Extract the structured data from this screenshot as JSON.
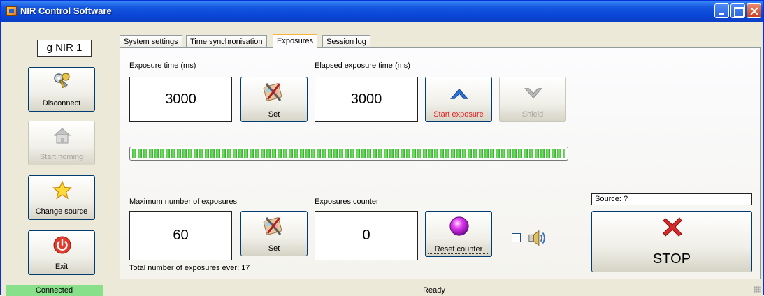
{
  "window": {
    "title": "NIR Control Software"
  },
  "sidebar": {
    "device_name": "g NIR 1",
    "buttons": [
      {
        "label": "Disconnect",
        "icon": "keys-icon",
        "enabled": true
      },
      {
        "label": "Start homing",
        "icon": "home-icon",
        "enabled": false
      },
      {
        "label": "Change source",
        "icon": "star-icon",
        "enabled": true
      },
      {
        "label": "Exit",
        "icon": "power-icon",
        "enabled": true
      }
    ]
  },
  "tabs": [
    {
      "label": "System settings",
      "active": false
    },
    {
      "label": "Time synchronisation",
      "active": false
    },
    {
      "label": "Exposures",
      "active": true
    },
    {
      "label": "Session log",
      "active": false
    }
  ],
  "exposures": {
    "exposure_time_label": "Exposure time (ms)",
    "exposure_time_value": "3000",
    "set_label": "Set",
    "elapsed_label": "Elapsed exposure time (ms)",
    "elapsed_value": "3000",
    "start_exposure_label": "Start exposure",
    "shield_label": "Shield",
    "progress_fraction": 1.0,
    "max_exposures_label": "Maximum number of exposures",
    "max_exposures_value": "60",
    "counter_label": "Exposures counter",
    "counter_value": "0",
    "reset_counter_label": "Reset counter",
    "total_exposures_text": "Total number of exposures ever: 17",
    "sound_checked": false,
    "source_text": "Source: ?",
    "stop_label": "STOP"
  },
  "status": {
    "connection": "Connected",
    "state": "Ready"
  },
  "colors": {
    "titlebar": "#0a46d6",
    "connected_bg": "#88e08a",
    "start_exposure_text": "#e02020",
    "progress_green": "#3ec23a"
  }
}
